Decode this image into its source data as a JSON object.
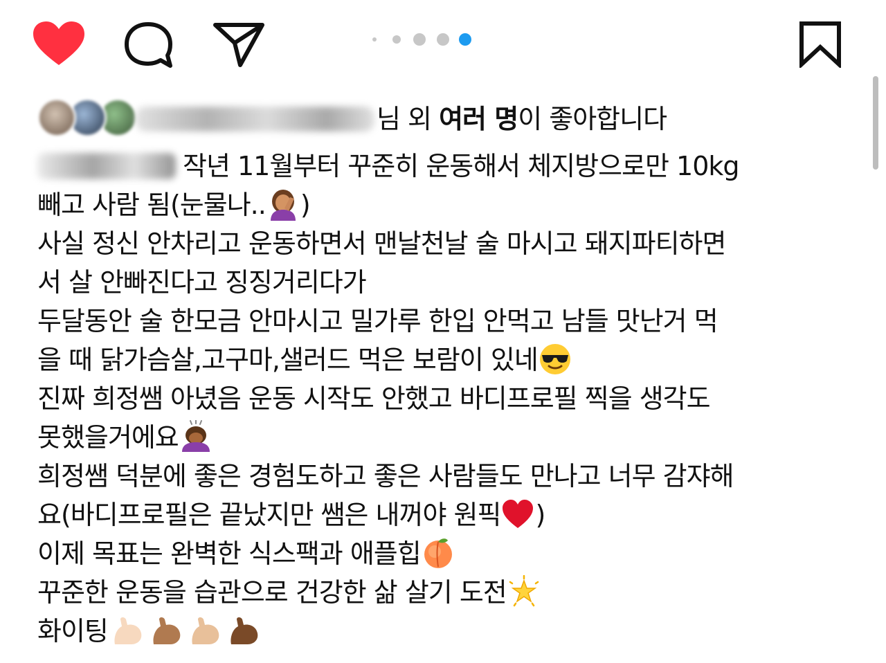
{
  "actions": {
    "like": {
      "icon": "heart-filled-icon",
      "color": "#ff3040"
    },
    "comment": {
      "icon": "comment-bubble-icon"
    },
    "share": {
      "icon": "paper-plane-icon"
    },
    "save": {
      "icon": "bookmark-icon"
    }
  },
  "carousel": {
    "dots_total": 5,
    "active_index": 4,
    "accent_color": "#1d9bf0"
  },
  "likes": {
    "suffix": "님 외 ",
    "others_bold": "여러 명",
    "tail": "이 좋아합니다"
  },
  "caption": {
    "lines": [
      {
        "text": "작년 11월부터 꾸준히 운동해서 체지방으로만 10kg"
      },
      {
        "text": "빼고 사람 됨(눈물나..",
        "emoji": "face-palm-emoji",
        "after": ")"
      },
      {
        "text": "사실 정신 안차리고 운동하면서 맨날천날 술 마시고 돼지파티하면"
      },
      {
        "text": "서 살 안빠진다고 징징거리다가"
      },
      {
        "text": "두달동안 술 한모금 안마시고 밀가루 한입 안먹고 남들 맛난거 먹"
      },
      {
        "text": "을 때 닭가슴살,고구마,샐러드 먹은 보람이 있네",
        "emoji": "sunglasses-emoji"
      },
      {
        "text": "진짜 희정쌤 아녔음 운동 시작도 안했고 바디프로필 찍을 생각도"
      },
      {
        "text": "못했을거에요",
        "emoji": "bowing-person-emoji"
      },
      {
        "text": "희정쌤 덕분에 좋은 경험도하고 좋은 사람들도 만나고 너무 감쟈해"
      },
      {
        "text": "요(바디프로필은 끝났지만 쌤은 내꺼야 원픽",
        "emoji": "red-heart-emoji",
        "after": ")"
      },
      {
        "text": "이제 목표는 완벽한 식스팩과 애플힙",
        "emoji": "peach-emoji"
      },
      {
        "text": "꾸준한 운동을 습관으로 건강한 삶 살기 도전",
        "emoji": "glowing-star-emoji"
      },
      {
        "text": "화이팅",
        "emoji": "flexed-biceps-emoji-row"
      }
    ]
  }
}
